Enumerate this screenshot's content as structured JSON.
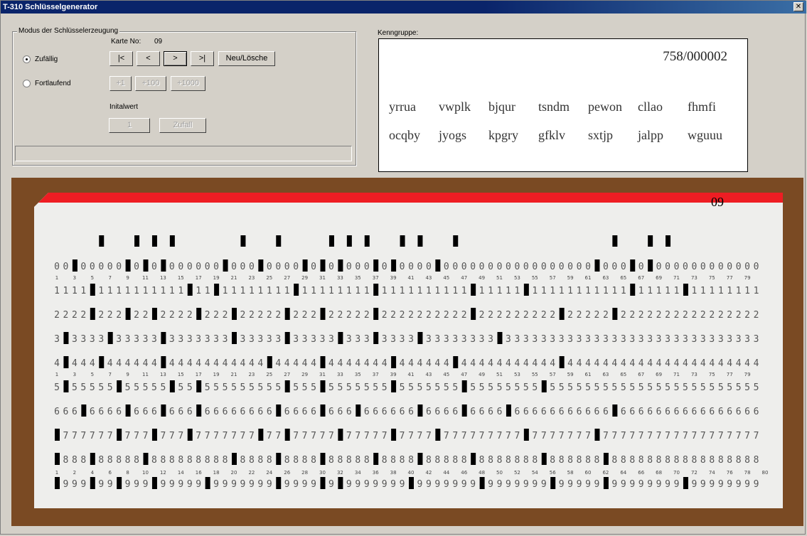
{
  "window": {
    "title": "T-310 Schlüsselgenerator",
    "close_glyph": "✕"
  },
  "mode_group": {
    "legend": "Modus der Schlüsselerzeugung",
    "karte_label": "Karte No:",
    "karte_value": "09",
    "radio_random": {
      "label": "Zufällig",
      "checked": true
    },
    "radio_sequential": {
      "label": "Fortlaufend",
      "checked": false
    },
    "nav_buttons": [
      "|<",
      "<",
      ">",
      ">|"
    ],
    "new_delete_label": "Neu/Lösche",
    "step_buttons": [
      "+1",
      "+100",
      "+1000"
    ],
    "initial_label": "Initalwert",
    "initial_value": "1",
    "random_button_label": "Zufall"
  },
  "kenngruppe": {
    "label": "Kenngruppe:",
    "number": "758/000002",
    "row1": [
      "yrrua",
      "vwplk",
      "bjqur",
      "tsndm",
      "pewon",
      "cllao",
      "fhmfi"
    ],
    "row2": [
      "ocqby",
      "jyogs",
      "kpgry",
      "gfklv",
      "sxtjp",
      "jalpp",
      "wguuu"
    ]
  },
  "card": {
    "number": "09",
    "columns": 80,
    "digit_rows": [
      "0",
      "1",
      "2",
      "3",
      "4",
      "5",
      "6",
      "7",
      "8",
      "9"
    ],
    "column_numbers": [
      "1",
      "3",
      "5",
      "7",
      "9",
      "11",
      "13",
      "15",
      "17",
      "19",
      "21",
      "23",
      "25",
      "27",
      "29",
      "31",
      "33",
      "35",
      "37",
      "39",
      "41",
      "43",
      "45",
      "47",
      "49",
      "51",
      "53",
      "55",
      "57",
      "59",
      "61",
      "63",
      "65",
      "67",
      "69",
      "71",
      "73",
      "75",
      "77",
      "79"
    ],
    "bottom_numbers": [
      "1",
      "2",
      "4",
      "6",
      "8",
      "10",
      "12",
      "14",
      "16",
      "18",
      "20",
      "22",
      "24",
      "26",
      "28",
      "30",
      "32",
      "34",
      "36",
      "38",
      "40",
      "42",
      "44",
      "46",
      "48",
      "50",
      "52",
      "54",
      "56",
      "58",
      "60",
      "62",
      "64",
      "66",
      "68",
      "70",
      "72",
      "74",
      "76",
      "78",
      "80"
    ],
    "punches": [
      [
        3,
        9,
        11,
        13,
        20,
        24,
        29,
        31,
        33,
        37,
        39,
        44,
        62,
        66,
        68
      ],
      [
        5,
        16,
        19,
        28,
        37,
        48,
        54,
        66,
        72
      ],
      [
        5,
        9,
        12,
        17,
        21,
        27,
        31,
        37,
        48,
        58,
        64
      ],
      [
        2,
        7,
        13,
        21,
        27,
        33,
        37,
        42,
        51
      ],
      [
        2,
        6,
        13,
        25,
        31,
        39,
        46,
        58
      ],
      [
        2,
        8,
        14,
        17,
        27,
        31,
        39,
        47,
        56
      ],
      [
        4,
        9,
        13,
        17,
        26,
        31,
        35,
        42,
        47,
        52,
        64
      ],
      [
        1,
        8,
        12,
        16,
        24,
        27,
        33,
        39,
        44,
        54,
        62
      ],
      [
        1,
        5,
        11,
        21,
        26,
        31,
        37,
        42,
        48,
        56,
        63
      ],
      [
        1,
        5,
        8,
        12,
        18,
        26,
        31,
        33,
        41,
        49,
        57,
        63,
        72
      ]
    ]
  },
  "colors": {
    "title_bar": "#0a246a",
    "card_stripe": "#ee1d23",
    "card_panel": "#7a4a23"
  }
}
